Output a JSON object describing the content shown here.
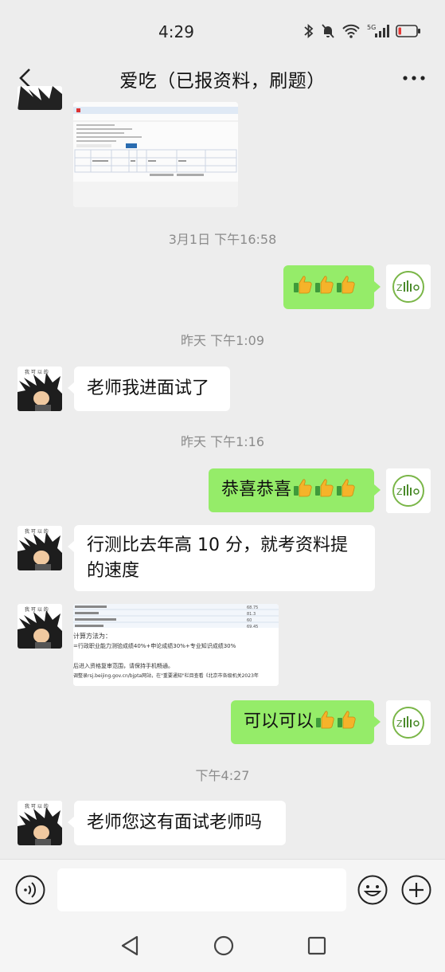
{
  "status": {
    "time": "4:29"
  },
  "header": {
    "title": "爱吃（已报资料，刷题）"
  },
  "messages": {
    "ts1": "3月1日 下午16:58",
    "ts2": "昨天 下午1:09",
    "m2": "老师我进面试了",
    "ts3": "昨天 下午1:16",
    "m3": "恭喜恭喜",
    "m4_line1": "行测比去年高 10 分，就考资料提",
    "m4_line2": "的速度",
    "m5": "可以可以",
    "ts4": "下午4:27",
    "m6": "老师您这有面试老师吗"
  },
  "avatar": {
    "left_caption": "我 可 以 的"
  },
  "image_msg_1": {
    "title": "准考证及成绩查询",
    "btn": "查询"
  },
  "image_msg_2": {
    "lines": [
      "计算方法为：",
      "=行政职业能力测验成绩40%+申论成绩30%+专业知识成绩30%",
      "后进入资格复审范围，请保持手机畅通。",
      "调整录rsj.beijing.gov.cn/bjpta网站，在\"重要通知\"栏目查看《北京市各级机关2023年"
    ],
    "scores": [
      "68.75",
      "81.3",
      "60",
      "69.45"
    ]
  },
  "colors": {
    "bg": "#ededed",
    "bubble_green": "#95ec69",
    "bubble_white": "#ffffff",
    "timestamp": "#8c8c8c"
  }
}
